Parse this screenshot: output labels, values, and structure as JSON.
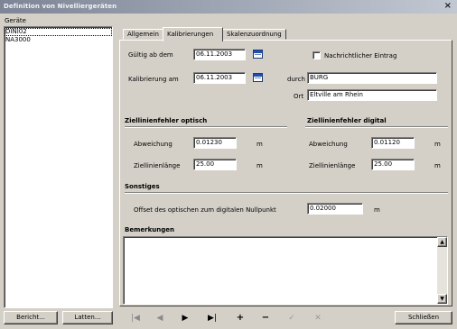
{
  "window": {
    "title": "Definition von Nivelliergeräten",
    "close_glyph": "×"
  },
  "devices": {
    "header": "Geräte",
    "items": [
      "DINI02",
      "NA3000"
    ]
  },
  "tabs": [
    "Allgemein",
    "Kalibrierungen",
    "Skalenzuordnung"
  ],
  "form": {
    "valid_from_label": "Gültig ab dem",
    "valid_from_value": "06.11.2003",
    "calibration_label": "Kalibrierung am",
    "calibration_value": "06.11.2003",
    "message_checkbox_label": "Nachrichtlicher Eintrag",
    "by_label": "durch",
    "by_value": "BURG",
    "place_label": "Ort",
    "place_value": "Eltville am Rhein"
  },
  "optical": {
    "heading": "Ziellinienfehler optisch",
    "deviation_label": "Abweichung",
    "deviation_value": "0.01230",
    "deviation_unit": "m",
    "length_label": "Ziellinienlänge",
    "length_value": "25.00",
    "length_unit": "m"
  },
  "digital": {
    "heading": "Ziellinienfehler digital",
    "deviation_label": "Abweichung",
    "deviation_value": "0.01120",
    "deviation_unit": "m",
    "length_label": "Ziellinienlänge",
    "length_value": "25.00",
    "length_unit": "m"
  },
  "other": {
    "heading": "Sonstiges",
    "offset_label": "Offset des optischen zum digitalen Nullpunkt",
    "offset_value": "0.02000",
    "offset_unit": "m"
  },
  "remarks": {
    "heading": "Bemerkungen",
    "value": ""
  },
  "footer": {
    "report_button": "Bericht...",
    "staffs_button": "Latten...",
    "close_button": "Schließen",
    "nav": [
      "|◀",
      "◀",
      "▶",
      "▶|",
      "+",
      "−",
      "✓",
      "✕"
    ]
  },
  "colors": {
    "face": "#d4d0c8",
    "titlebar_start": "#7d8596",
    "titlebar_end": "#c2c8d2"
  }
}
